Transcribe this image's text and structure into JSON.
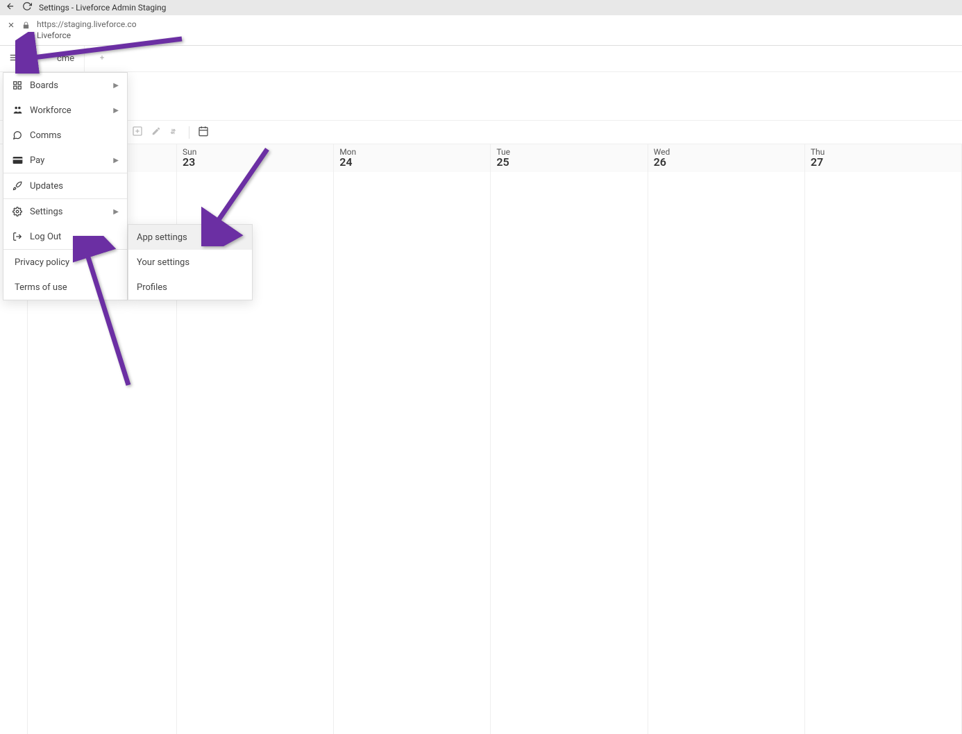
{
  "browser": {
    "page_title": "Settings - Liveforce Admin Staging",
    "url": "https://staging.liveforce.co",
    "site_name": "Liveforce"
  },
  "app_bar": {
    "tab_label": "cme"
  },
  "menu": {
    "items": [
      {
        "label": "Boards",
        "icon": "grid",
        "caret": true
      },
      {
        "label": "Workforce",
        "icon": "people",
        "caret": true
      },
      {
        "label": "Comms",
        "icon": "chat",
        "caret": false
      },
      {
        "label": "Pay",
        "icon": "wallet",
        "caret": true
      }
    ],
    "updates_label": "Updates",
    "settings_label": "Settings",
    "logout_label": "Log Out",
    "privacy_label": "Privacy policy",
    "terms_label": "Terms of use"
  },
  "submenu": {
    "items": [
      "App settings",
      "Your settings",
      "Profiles"
    ]
  },
  "calendar": {
    "days": [
      {
        "dow": "Sun",
        "num": "23"
      },
      {
        "dow": "Mon",
        "num": "24"
      },
      {
        "dow": "Tue",
        "num": "25"
      },
      {
        "dow": "Wed",
        "num": "26"
      },
      {
        "dow": "Thu",
        "num": "27"
      }
    ]
  }
}
